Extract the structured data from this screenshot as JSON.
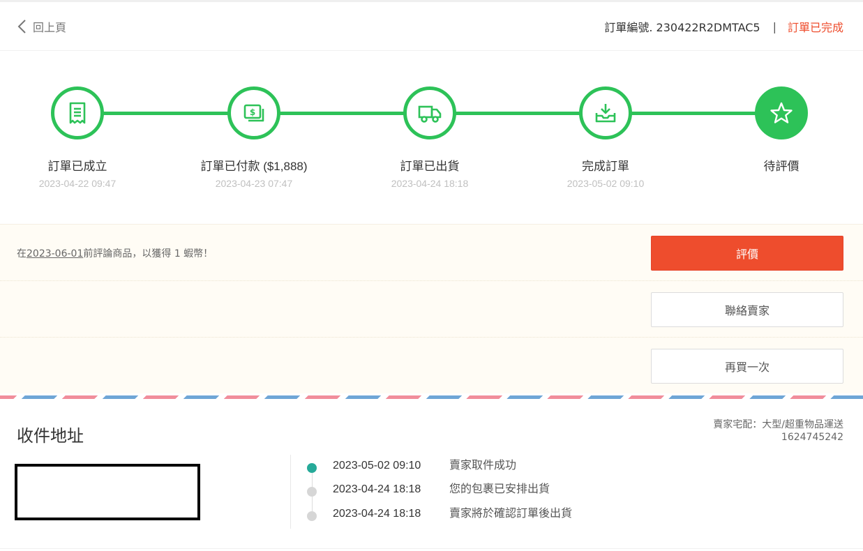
{
  "header": {
    "back_label": "回上頁",
    "order_number": "訂單編號. 230422R2DMTAC5",
    "separator": "|",
    "status": "訂單已完成"
  },
  "steps": [
    {
      "label": "訂單已成立",
      "time": "2023-04-22 09:47",
      "icon": "receipt-icon"
    },
    {
      "label": "訂單已付款 ($1,888)",
      "time": "2023-04-23 07:47",
      "icon": "cash-icon"
    },
    {
      "label": "訂單已出貨",
      "time": "2023-04-24 18:18",
      "icon": "truck-icon"
    },
    {
      "label": "完成訂單",
      "time": "2023-05-02 09:10",
      "icon": "inbox-download-icon"
    },
    {
      "label": "待評價",
      "time": "",
      "icon": "star-icon"
    }
  ],
  "review": {
    "prefix": "在",
    "date": "2023-06-01",
    "suffix": "前評論商品，以獲得 1 蝦幣！"
  },
  "buttons": {
    "rate": "評價",
    "contact_seller": "聯絡賣家",
    "buy_again": "再買一次"
  },
  "address": {
    "title": "收件地址"
  },
  "shipping": {
    "carrier": "賣家宅配：大型/超重物品運送",
    "tracking_number": "1624745242"
  },
  "tracking": [
    {
      "time": "2023-05-02 09:10",
      "desc": "賣家取件成功",
      "active": true
    },
    {
      "time": "2023-04-24 18:18",
      "desc": "您的包裹已安排出貨",
      "active": false
    },
    {
      "time": "2023-04-24 18:18",
      "desc": "賣家將於確認訂單後出貨",
      "active": false
    }
  ],
  "colors": {
    "brand": "#ee4d2d",
    "progress": "#2dc258",
    "tracking_active": "#26aa99"
  }
}
